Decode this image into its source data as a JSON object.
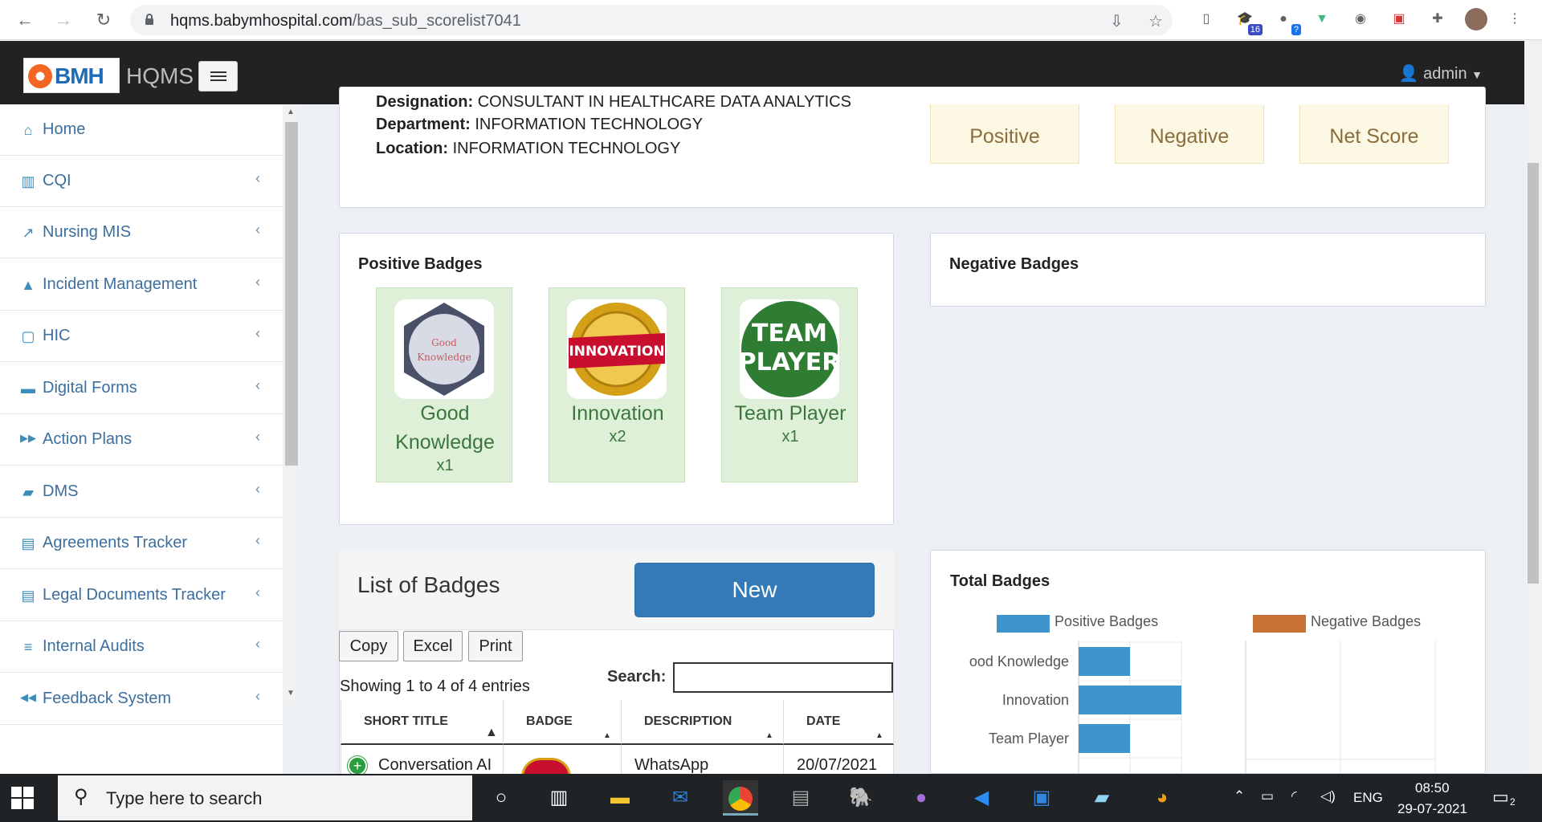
{
  "browser": {
    "url_host": "hqms.babymhospital.com",
    "url_path": "/bas_sub_scorelist7041",
    "extension_badges": [
      "16",
      "?"
    ]
  },
  "header": {
    "logo_text": "BMH",
    "app_name": "HQMS",
    "user": "admin"
  },
  "sidebar": {
    "items": [
      {
        "label": "Home",
        "icon": "home-icon"
      },
      {
        "label": "CQI",
        "icon": "bar-chart-icon"
      },
      {
        "label": "Nursing MIS",
        "icon": "line-chart-icon"
      },
      {
        "label": "Incident Management",
        "icon": "warning-icon"
      },
      {
        "label": "HIC",
        "icon": "sticky-note-icon"
      },
      {
        "label": "Digital Forms",
        "icon": "archive-icon"
      },
      {
        "label": "Action Plans",
        "icon": "fast-forward-icon"
      },
      {
        "label": "DMS",
        "icon": "folder-icon"
      },
      {
        "label": "Agreements Tracker",
        "icon": "file-text-icon"
      },
      {
        "label": "Legal Documents Tracker",
        "icon": "file-icon"
      },
      {
        "label": "Internal Audits",
        "icon": "list-icon"
      },
      {
        "label": "Feedback System",
        "icon": "backward-icon"
      }
    ]
  },
  "profile": {
    "designation_label": "Designation:",
    "designation_value": "CONSULTANT IN HEALTHCARE DATA ANALYTICS",
    "department_label": "Department:",
    "department_value": "INFORMATION TECHNOLOGY",
    "location_label": "Location:",
    "location_value": "INFORMATION TECHNOLOGY"
  },
  "scores": {
    "positive": "Positive",
    "negative": "Negative",
    "net": "Net Score"
  },
  "positive_badges": {
    "title": "Positive Badges",
    "items": [
      {
        "name_line1": "Good",
        "name_line2": "Knowledge",
        "count": "x1",
        "img_text1": "Good",
        "img_text2": "Knowledge"
      },
      {
        "name_line1": "Innovation",
        "count": "x2",
        "img_text": "INNOVATION"
      },
      {
        "name_line1": "Team Player",
        "count": "x1",
        "img_text1": "TEAM",
        "img_text2": "PLAYER"
      }
    ]
  },
  "negative_badges": {
    "title": "Negative Badges"
  },
  "badge_list": {
    "title": "List of Badges",
    "new_button": "New",
    "buttons": [
      "Copy",
      "Excel",
      "Print"
    ],
    "search_label": "Search:",
    "showing": "Showing 1 to 4 of 4 entries",
    "columns": [
      "SHORT TITLE",
      "BADGE",
      "DESCRIPTION",
      "DATE"
    ],
    "rows": [
      {
        "short_title": "Conversation AI",
        "description": "WhatsApp",
        "date": "20/07/2021"
      }
    ]
  },
  "total_badges": {
    "title": "Total Badges"
  },
  "chart_data": {
    "type": "bar",
    "orientation": "horizontal",
    "title": "Total Badges",
    "categories": [
      "ood Knowledge",
      "Innovation",
      "Team Player"
    ],
    "series": [
      {
        "name": "Positive Badges",
        "values": [
          1,
          2,
          1
        ],
        "color": "#3e95cd"
      },
      {
        "name": "Negative Badges",
        "values": [
          0,
          0,
          0
        ],
        "color": "#c45850"
      }
    ],
    "xlim": [
      0,
      2
    ],
    "grid": true,
    "legend": "top"
  },
  "taskbar": {
    "search_placeholder": "Type here to search",
    "language": "ENG",
    "time": "08:50",
    "date": "29-07-2021",
    "notifications": "2"
  },
  "colors": {
    "primary": "#337ab7",
    "sidebar_link": "#3c6e9e",
    "badge_bg": "#dff0d8",
    "score_bg": "#fcf8e3"
  }
}
